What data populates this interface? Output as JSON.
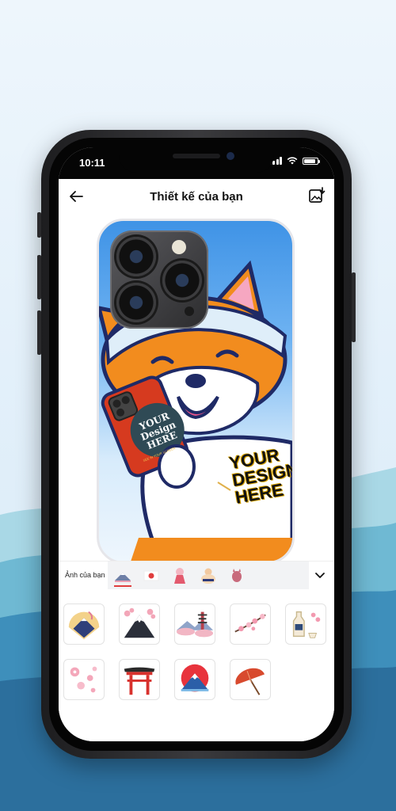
{
  "status": {
    "time": "10:11"
  },
  "appbar": {
    "title": "Thiết kế của bạn"
  },
  "design": {
    "badge_small": "YOUR Design HERE",
    "badge_small_sub": "SEE IN YOUR SCREEN",
    "shirt_text": [
      "YOUR",
      "DESIGN",
      "HERE"
    ]
  },
  "tabs": {
    "label": "Ảnh của bạn"
  },
  "icons": {
    "back": "arrow-left-icon",
    "save": "image-download-icon",
    "expand": "chevron-down-icon",
    "signal": "cellular-signal-icon",
    "wifi": "wifi-icon",
    "battery": "battery-icon"
  },
  "colors": {
    "accent": "#e03d3d",
    "case_blue": "#3f93e6",
    "shiba_orange": "#f28c1e",
    "navy": "#1f2a66"
  }
}
